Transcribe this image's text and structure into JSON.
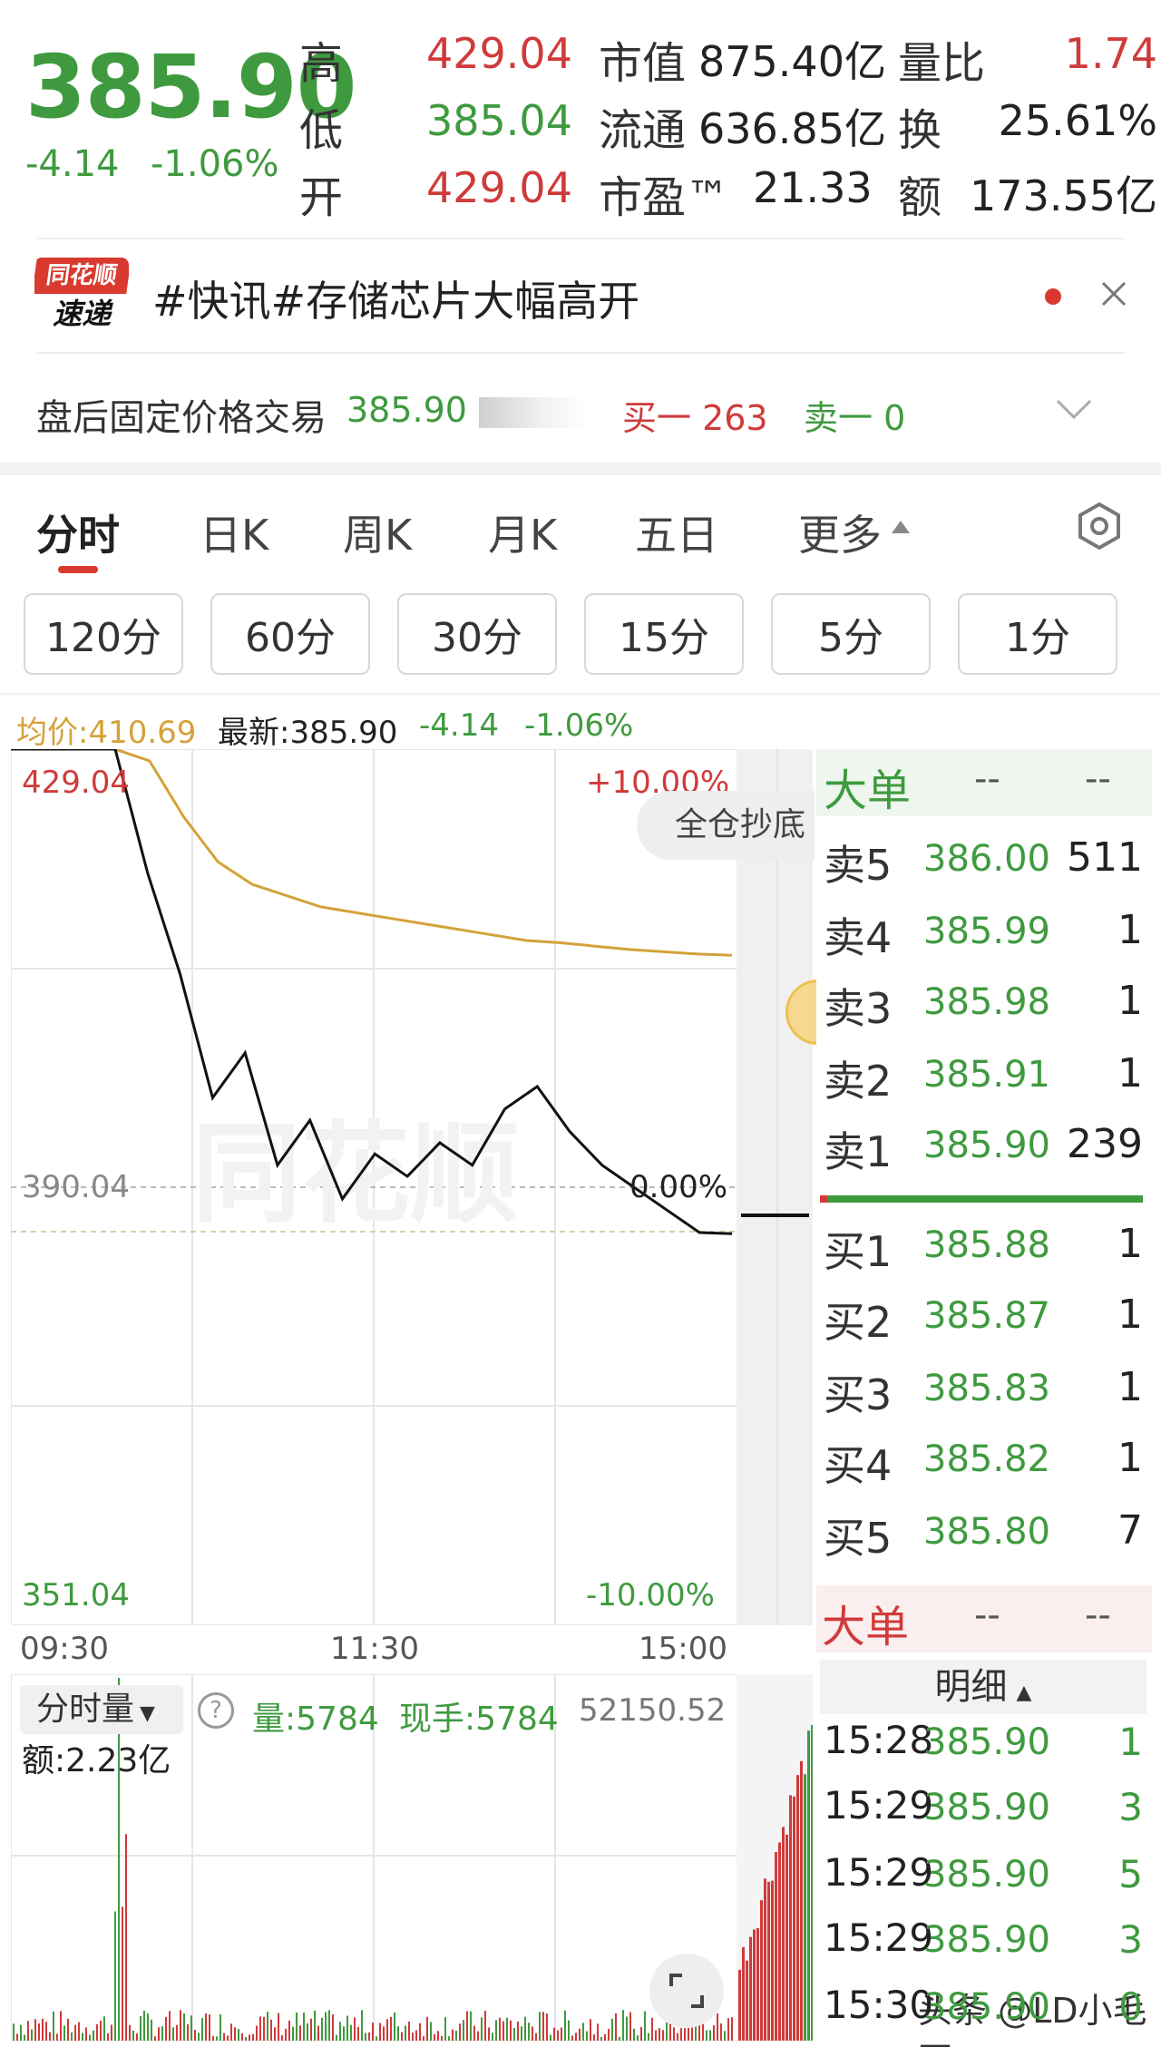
{
  "quote": {
    "price": "385.90",
    "change": "-4.14",
    "change_pct": "-1.06%",
    "stats": [
      {
        "label": "高",
        "value": "429.04",
        "color": "red"
      },
      {
        "label": "低",
        "value": "385.04",
        "color": "green"
      },
      {
        "label": "开",
        "value": "429.04",
        "color": "red"
      }
    ],
    "stats2": [
      {
        "label": "市值",
        "value": "875.40亿"
      },
      {
        "label": "流通",
        "value": "636.85亿"
      },
      {
        "label": "市盈™",
        "value": "21.33"
      }
    ],
    "stats3": [
      {
        "label": "量比",
        "value": "1.74",
        "color": "red"
      },
      {
        "label": "换",
        "value": "25.61%"
      },
      {
        "label": "额",
        "value": "173.55亿"
      }
    ]
  },
  "news": {
    "logo_line1": "同花顺",
    "logo_line2": "速递",
    "text": "#快讯#存储芯片大幅高开"
  },
  "after_hours": {
    "label": "盘后固定价格交易",
    "price": "385.90",
    "bid_label": "买一 263",
    "ask_label": "卖一 0"
  },
  "tabs": [
    "分时",
    "日K",
    "周K",
    "月K",
    "五日",
    "更多"
  ],
  "intervals": [
    "120分",
    "60分",
    "30分",
    "15分",
    "5分",
    "1分"
  ],
  "chart_info": {
    "avg": "均价:410.69",
    "latest": "最新:385.90",
    "chg": "-4.14",
    "chg_pct": "-1.06%",
    "top_price": "429.04",
    "top_pct": "+10.00%",
    "mid_price": "390.04",
    "mid_pct": "0.00%",
    "bottom_price": "351.04",
    "bottom_pct": "-10.00%",
    "promo": "全仓抄底",
    "watermark": "同花顺",
    "time_labels": [
      "09:30",
      "11:30",
      "15:00"
    ]
  },
  "volume_panel": {
    "selector": "分时量",
    "help": "?",
    "vol": "量:5784",
    "now": "现手:5784",
    "right_value": "52150.52",
    "amount": "额:2.23亿"
  },
  "orderbook": {
    "big_order_label": "大单",
    "placeholder": "--",
    "asks": [
      {
        "label": "卖5",
        "price": "386.00",
        "qty": "511"
      },
      {
        "label": "卖4",
        "price": "385.99",
        "qty": "1"
      },
      {
        "label": "卖3",
        "price": "385.98",
        "qty": "1"
      },
      {
        "label": "卖2",
        "price": "385.91",
        "qty": "1"
      },
      {
        "label": "卖1",
        "price": "385.90",
        "qty": "239"
      }
    ],
    "bids": [
      {
        "label": "买1",
        "price": "385.88",
        "qty": "1"
      },
      {
        "label": "买2",
        "price": "385.87",
        "qty": "1"
      },
      {
        "label": "买3",
        "price": "385.83",
        "qty": "1"
      },
      {
        "label": "买4",
        "price": "385.82",
        "qty": "1"
      },
      {
        "label": "买5",
        "price": "385.80",
        "qty": "7"
      }
    ],
    "detail_label": "明细",
    "ticks": [
      {
        "time": "15:28",
        "price": "385.90",
        "qty": "1"
      },
      {
        "time": "15:29",
        "price": "385.90",
        "qty": "3"
      },
      {
        "time": "15:29",
        "price": "385.90",
        "qty": "5"
      },
      {
        "time": "15:29",
        "price": "385.90",
        "qty": "3"
      },
      {
        "time": "15:30",
        "price": "385.90",
        "qty": "0"
      }
    ]
  },
  "footer_watermark": "头条 @LD小毛哥",
  "colors": {
    "up": "#d03a3a",
    "down": "#3f9a3f",
    "avg_line": "#d4a23a",
    "price_line": "#111111"
  },
  "chart_data": {
    "type": "line",
    "x": [
      "09:30",
      "11:30",
      "15:00"
    ],
    "ylim": [
      351.04,
      429.04
    ],
    "series": [
      {
        "values": [
          429.04,
          429.04,
          418,
          409,
          398,
          402,
          392,
          396,
          389,
          393,
          391,
          394,
          392,
          397,
          399,
          395,
          392,
          390,
          388,
          386,
          385.9
        ]
      },
      {
        "values": [
          429.04,
          428,
          423,
          419,
          417,
          416,
          415,
          414.5,
          414,
          413.5,
          413,
          412.5,
          412,
          411.8,
          411.5,
          411.2,
          411,
          410.8,
          410.69
        ]
      }
    ]
  }
}
